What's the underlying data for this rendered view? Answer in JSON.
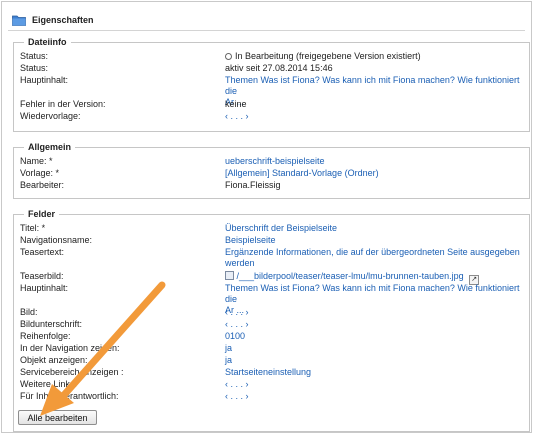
{
  "window": {
    "title": "Eigenschaften"
  },
  "dateiinfo": {
    "legend": "Dateiinfo",
    "rows": [
      {
        "label": "Status:",
        "value": "In Bearbeitung (freigegebene Version existiert)"
      },
      {
        "label": "Status:",
        "value": "aktiv seit 27.08.2014 15:46"
      },
      {
        "label": "Hauptinhalt:",
        "value_line1": "Themen Was ist Fiona? Was kann ich mit Fiona machen? Wie funktioniert die",
        "value_line2": "Ar ..."
      },
      {
        "label": "Fehler in der Version:",
        "value": "keine"
      },
      {
        "label": "Wiedervorlage:",
        "value": "‹ . . . ›"
      }
    ]
  },
  "allgemein": {
    "legend": "Allgemein",
    "rows": [
      {
        "label": "Name: *",
        "value": "ueberschrift-beispielseite"
      },
      {
        "label": "Vorlage: *",
        "value": "[Allgemein] Standard-Vorlage (Ordner)"
      },
      {
        "label": "Bearbeiter:",
        "value": "Fiona.Fleissig"
      }
    ]
  },
  "felder": {
    "legend": "Felder",
    "rows": [
      {
        "label": "Titel: *",
        "value": "Überschrift der Beispielseite"
      },
      {
        "label": "Navigationsname:",
        "value": "Beispielseite"
      },
      {
        "label": "Teasertext:",
        "value_line1": "Ergänzende Informationen, die auf der übergeordneten Seite ausgegeben",
        "value_line2": "werden"
      },
      {
        "label": "Teaserbild:",
        "value": "/___bilderpool/teaser/teaser-lmu/lmu-brunnen-tauben.jpg"
      },
      {
        "label": "Hauptinhalt:",
        "value_line1": "Themen Was ist Fiona? Was kann ich mit Fiona machen? Wie funktioniert die",
        "value_line2": "Ar ..."
      },
      {
        "label": "Bild:",
        "value": "‹ . . . ›"
      },
      {
        "label": "Bildunterschrift:",
        "value": "‹ . . . ›"
      },
      {
        "label": "Reihenfolge:",
        "value": "0100"
      },
      {
        "label": "In der Navigation zeigen:",
        "value": "ja"
      },
      {
        "label": "Objekt anzeigen:",
        "value": "ja"
      },
      {
        "label": "Servicebereich anzeigen :",
        "value": "Startseiteneinstellung"
      },
      {
        "label": "Weitere Links:",
        "value": "‹ . . . ›"
      },
      {
        "label": "Für Inhalt verantwortlich:",
        "value": "‹ . . . ›"
      }
    ]
  },
  "actions": {
    "edit_all": "Alle bearbeiten"
  },
  "colors": {
    "link": "#1b5fb4",
    "arrow": "#f29a3a",
    "folder": "#3d7fd1"
  },
  "icons": {
    "title": "folder-icon",
    "status": "status-dot-icon",
    "teaserbild_left": "image-icon",
    "teaserbild_right": "open-external-icon"
  }
}
